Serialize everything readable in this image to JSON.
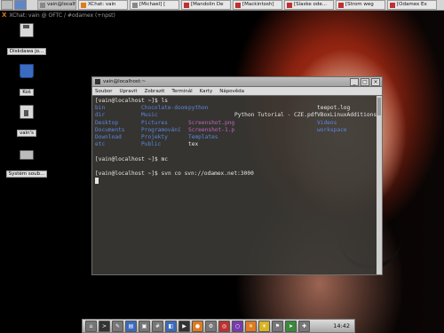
{
  "taskbar": {
    "tasks": [
      {
        "label": "vain@localh",
        "icon": "terminal-icon",
        "color": "gray",
        "active": true
      },
      {
        "label": "XChat: vain",
        "icon": "xchat-icon",
        "color": "orange",
        "active": false
      },
      {
        "label": "[Michael] [",
        "icon": "terminal-icon",
        "color": "gray",
        "active": false
      },
      {
        "label": "[Mandolin De",
        "icon": "browser-icon",
        "color": "red",
        "active": false
      },
      {
        "label": "[Mackintosh]",
        "icon": "browser-icon",
        "color": "red",
        "active": false
      },
      {
        "label": "[Síaske ode...",
        "icon": "browser-icon",
        "color": "red",
        "active": false
      },
      {
        "label": "[Strom weg",
        "icon": "browser-icon",
        "color": "red",
        "active": false
      },
      {
        "label": "[Odamex Ex",
        "icon": "browser-icon",
        "color": "red",
        "active": false
      }
    ]
  },
  "desktop": {
    "title_prefix": "X",
    "title": "XChat: vain @ OFTC / #odamex (+npst)",
    "icons": [
      {
        "label": "Diskdawa jo...",
        "icon": "floppy-icon"
      },
      {
        "label": "Koš",
        "icon": "trash-icon"
      },
      {
        "label": "vain's",
        "icon": "home-icon"
      },
      {
        "label": "Systém soub...",
        "icon": "drive-icon"
      }
    ]
  },
  "terminal": {
    "title": "vain@localhost:~",
    "buttons": {
      "minimize": "_",
      "maximize": "□",
      "close": "×"
    },
    "menu": [
      "Soubor",
      "Upravit",
      "Zobrazit",
      "Terminál",
      "Karty",
      "Nápověda"
    ],
    "lines": {
      "l1": "[vain@localhost ~]$ ls",
      "l9": "[vain@localhost ~]$ mc",
      "l10": "",
      "l11": "[vain@localhost ~]$ svn co svn://odamex.net:3000"
    },
    "ls_rows": [
      [
        {
          "t": "bin",
          "k": "dir"
        },
        {
          "t": "Chocolate-doom",
          "k": "dir"
        },
        {
          "t": "python",
          "k": "dir"
        },
        {
          "t": "",
          "k": "file"
        },
        {
          "t": "teepot.log",
          "k": "file"
        }
      ],
      [
        {
          "t": "dir",
          "k": "dir"
        },
        {
          "t": "Music",
          "k": "dir"
        },
        {
          "t": "",
          "k": "file"
        },
        {
          "t": "Python Tutorial - CZE.pdf",
          "k": "file"
        },
        {
          "t": "VBoxLinuxAdditions.run",
          "k": "file"
        }
      ],
      [
        {
          "t": "Desktop",
          "k": "dir"
        },
        {
          "t": "Pictures",
          "k": "dir"
        },
        {
          "t": "Screenshot.png",
          "k": "img-file"
        },
        {
          "t": "",
          "k": "file"
        },
        {
          "t": "Videos",
          "k": "dir"
        }
      ],
      [
        {
          "t": "Documents",
          "k": "dir"
        },
        {
          "t": "Programování",
          "k": "dir"
        },
        {
          "t": "Screenshot-1.png",
          "k": "img-file"
        },
        {
          "t": "",
          "k": "file"
        },
        {
          "t": "workspace",
          "k": "dir"
        }
      ],
      [
        {
          "t": "Download",
          "k": "dir"
        },
        {
          "t": "Projekty",
          "k": "dir"
        },
        {
          "t": "Templates",
          "k": "dir"
        },
        {
          "t": "",
          "k": "file"
        },
        {
          "t": "",
          "k": "file"
        }
      ],
      [
        {
          "t": "etc",
          "k": "dir"
        },
        {
          "t": "Public",
          "k": "dir"
        },
        {
          "t": "tex",
          "k": "file"
        },
        {
          "t": "",
          "k": "file"
        },
        {
          "t": "",
          "k": "file"
        }
      ]
    ]
  },
  "dock": {
    "items": [
      {
        "name": "home-folder-icon",
        "glyph": "⌂",
        "color": "gray"
      },
      {
        "name": "terminal-icon",
        "glyph": ">",
        "color": "dark"
      },
      {
        "name": "text-editor-icon",
        "glyph": "✎",
        "color": "gray"
      },
      {
        "name": "file-manager-icon",
        "glyph": "▤",
        "color": "blue"
      },
      {
        "name": "monitor-icon",
        "glyph": "▣",
        "color": "gray"
      },
      {
        "name": "calculator-icon",
        "glyph": "#",
        "color": "gray"
      },
      {
        "name": "image-viewer-icon",
        "glyph": "◧",
        "color": "blue"
      },
      {
        "name": "video-icon",
        "glyph": "▶",
        "color": "dark"
      },
      {
        "name": "firefox-icon",
        "glyph": "●",
        "color": "orange"
      },
      {
        "name": "settings-icon",
        "glyph": "⚙",
        "color": "gray"
      },
      {
        "name": "lifebuoy-icon",
        "glyph": "◎",
        "color": "red"
      },
      {
        "name": "disc-icon",
        "glyph": "○",
        "color": "purple"
      },
      {
        "name": "xchat-icon",
        "glyph": "✕",
        "color": "orange"
      },
      {
        "name": "sun-icon",
        "glyph": "☀",
        "color": "yellow"
      },
      {
        "name": "flag-icon",
        "glyph": "⚑",
        "color": "gray"
      },
      {
        "name": "run-icon",
        "glyph": "➤",
        "color": "green"
      },
      {
        "name": "puzzle-icon",
        "glyph": "✚",
        "color": "gray"
      }
    ],
    "clock": "14:42"
  }
}
